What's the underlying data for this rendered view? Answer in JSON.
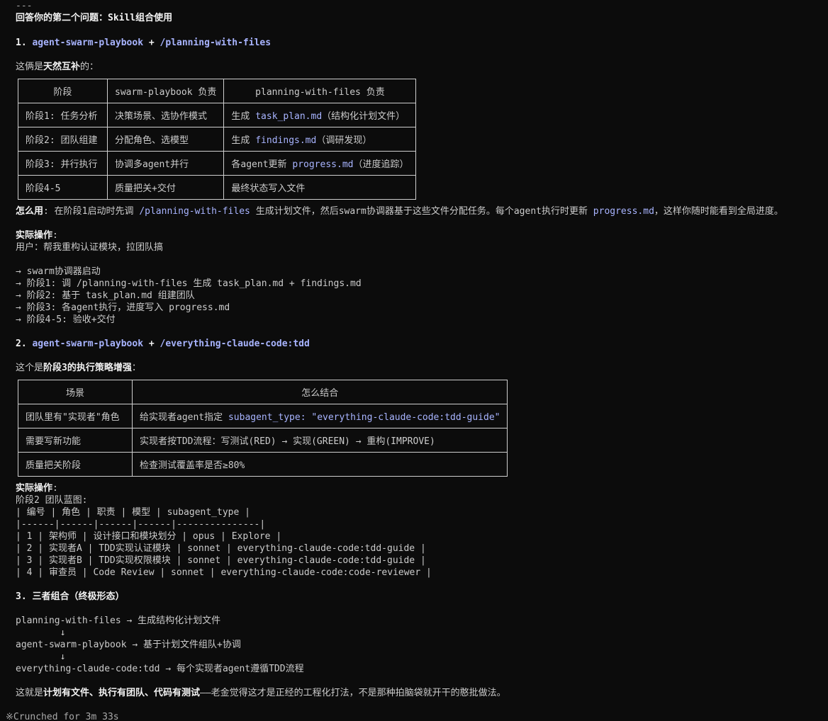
{
  "separator": "---",
  "heading": "回答你的第二个问题：Skill组合使用",
  "section1": {
    "title_num": "1.",
    "title_a": "agent-swarm-playbook",
    "title_plus": "+",
    "title_b": "/planning-with-files",
    "intro_pre": "这俩是",
    "intro_bold": "天然互补",
    "intro_post": "的：",
    "table": {
      "headers": [
        "阶段",
        "swarm-playbook 负责",
        "planning-with-files 负责"
      ],
      "rows": [
        {
          "stage": "阶段1: 任务分析",
          "swarm": "决策场景、选协作模式",
          "pwf_pre": "生成 ",
          "pwf_code": "task_plan.md",
          "pwf_post": "（结构化计划文件）"
        },
        {
          "stage": "阶段2: 团队组建",
          "swarm": "分配角色、选模型",
          "pwf_pre": "生成 ",
          "pwf_code": "findings.md",
          "pwf_post": "（调研发现）"
        },
        {
          "stage": "阶段3: 并行执行",
          "swarm": "协调多agent并行",
          "pwf_pre": "各agent更新 ",
          "pwf_code": "progress.md",
          "pwf_post": "（进度追踪）"
        },
        {
          "stage": "阶段4-5",
          "swarm": "质量把关+交付",
          "pwf_pre": "最终状态写入文件",
          "pwf_code": "",
          "pwf_post": ""
        }
      ]
    },
    "how_label": "怎么用",
    "how_text_1": ": 在阶段1启动时先调 ",
    "how_code_1": "/planning-with-files",
    "how_text_2": " 生成计划文件，然后swarm协调器基于这些文件分配任务。每个agent执行时更新 ",
    "how_code_2": "progress.md",
    "how_text_3": "，这样你随时能看到全局进度。",
    "practice_label": "实际操作",
    "practice_colon": ":",
    "practice_lines": [
      "用户：帮我重构认证模块，拉团队搞",
      "",
      "→ swarm协调器启动",
      "→ 阶段1: 调 /planning-with-files 生成 task_plan.md + findings.md",
      "→ 阶段2: 基于 task_plan.md 组建团队",
      "→ 阶段3: 各agent执行，进度写入 progress.md",
      "→ 阶段4-5: 验收+交付"
    ]
  },
  "section2": {
    "title_num": "2.",
    "title_a": "agent-swarm-playbook",
    "title_plus": "+",
    "title_b": "/everything-claude-code:tdd",
    "intro_pre": "这个是",
    "intro_bold": "阶段3的执行策略增强",
    "intro_post": "：",
    "table": {
      "headers": [
        "场景",
        "怎么结合"
      ],
      "rows": [
        {
          "scene": "团队里有\"实现者\"角色",
          "how_pre": "给实现者agent指定 ",
          "how_code": "subagent_type: \"everything-claude-code:tdd-guide\""
        },
        {
          "scene": "需要写新功能",
          "how_pre": "实现者按TDD流程：写测试(RED) → 实现(GREEN) → 重构(IMPROVE)",
          "how_code": ""
        },
        {
          "scene": "质量把关阶段",
          "how_pre": "检查测试覆盖率是否≥80%",
          "how_code": ""
        }
      ]
    },
    "practice_label": "实际操作",
    "practice_colon": ":",
    "practice_lines": [
      "阶段2 团队蓝图:",
      "| 编号 | 角色 | 职责 | 模型 | subagent_type |",
      "|------|------|------|------|---------------|",
      "| 1 | 架构师 | 设计接口和模块划分 | opus | Explore |",
      "| 2 | 实现者A | TDD实现认证模块 | sonnet | everything-claude-code:tdd-guide |",
      "| 3 | 实现者B | TDD实现权限模块 | sonnet | everything-claude-code:tdd-guide |",
      "| 4 | 审查员 | Code Review | sonnet | everything-claude-code:code-reviewer |"
    ]
  },
  "section3": {
    "title": "3. 三者组合（终极形态）",
    "flow_lines": [
      "planning-with-files → 生成结构化计划文件",
      "        ↓",
      "agent-swarm-playbook → 基于计划文件组队+协调",
      "        ↓",
      "everything-claude-code:tdd → 每个实现者agent遵循TDD流程"
    ],
    "summary_pre": "这就是",
    "summary_bold": "计划有文件、执行有团队、代码有测试",
    "summary_post": "——老金觉得这才是正经的工程化打法，不是那种拍脑袋就开干的憨批做法。"
  },
  "footer": {
    "icon": "※",
    "status": "Crunched for 3m 33s"
  }
}
